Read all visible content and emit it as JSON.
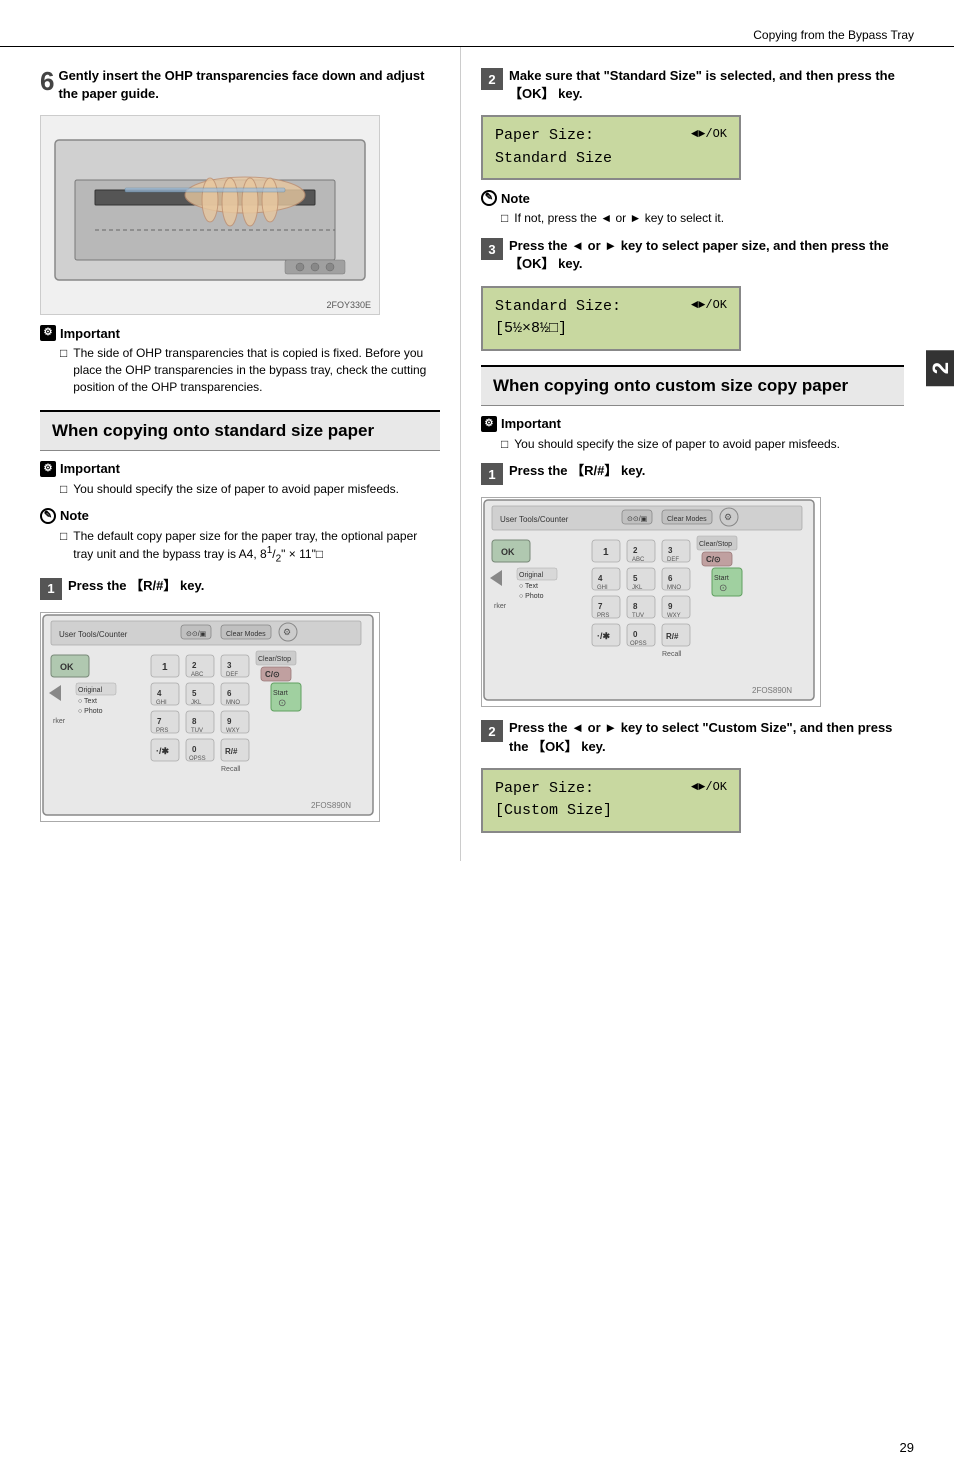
{
  "header": {
    "title": "Copying from the Bypass Tray",
    "page_number": "29",
    "chapter_num": "2"
  },
  "left_col": {
    "step6": {
      "number": "6",
      "text": "Gently insert the OHP transparencies face down and adjust the paper guide.",
      "image_label": "2FOY330E"
    },
    "important1": {
      "title": "Important",
      "item": "The side of OHP transparencies that is copied is fixed. Before you place the OHP transparencies in the bypass tray, check the cutting position of the OHP transparencies."
    },
    "section_standard": {
      "heading": "When copying onto standard size paper"
    },
    "important2": {
      "title": "Important",
      "item": "You should specify the size of paper to avoid paper misfeeds."
    },
    "note1": {
      "title": "Note",
      "item": "The default copy paper size for the paper tray, the optional paper tray unit and the bypass tray is A4, 8¹/₂\" × 11\""
    },
    "step1_left": {
      "number": "1",
      "text": "Press the 【R/#】 key."
    },
    "keyboard_label_left": "2FOS890N"
  },
  "right_col": {
    "step2_right": {
      "number": "2",
      "text": "Make sure that \"Standard Size\" is selected, and then press the 【OK】 key."
    },
    "lcd1": {
      "line1": "Paper Size:",
      "line2": "Standard Size",
      "icon": "◄►/OK"
    },
    "note2": {
      "title": "Note",
      "item": "If not, press the ◄ or ► key to select it."
    },
    "step3_right": {
      "number": "3",
      "text": "Press the ◄ or ► key to select paper size, and then press the 【OK】 key."
    },
    "lcd2": {
      "line1": "Standard Size:",
      "line2": "[5½×8½□]",
      "icon": "◄►/OK"
    },
    "section_custom": {
      "heading": "When copying onto custom size copy paper"
    },
    "important3": {
      "title": "Important",
      "item": "You should specify the size of paper to avoid paper misfeeds."
    },
    "step1_right": {
      "number": "1",
      "text": "Press the 【R/#】 key."
    },
    "keyboard_label_right": "2FOS890N",
    "step2_bottom": {
      "number": "2",
      "text": "Press the ◄ or ► key to select \"Custom Size\", and then press the 【OK】 key."
    },
    "lcd3": {
      "line1": "Paper Size:",
      "line2": "[Custom Size]",
      "icon": "◄►/OK"
    }
  }
}
